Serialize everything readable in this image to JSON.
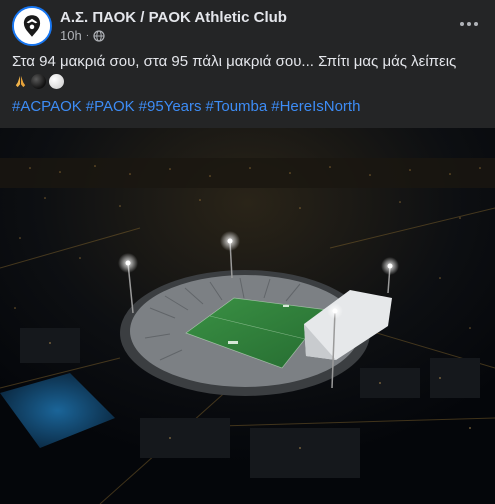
{
  "post": {
    "page_name": "Α.Σ. ΠΑΟΚ / PAOK Athletic Club",
    "time": "10h",
    "separator": "·",
    "privacy_icon": "globe-icon",
    "more_icon": "more-options-icon",
    "caption": "Στα 94 μακριά σου, στα 95 πάλι μακριά σου... Σπίτι μας μάς λείπεις",
    "emojis": [
      "folded-hands-icon",
      "black-ball-icon",
      "white-ball-icon"
    ],
    "hashtags": [
      "#ACPAOK",
      "#PAOK",
      "#95Years",
      "#Toumba",
      "#HereIsNorth"
    ],
    "photo": {
      "subject": "stadium-aerial-night-photo"
    }
  },
  "colors": {
    "background": "#242526",
    "text_primary": "#e4e6eb",
    "text_secondary": "#b0b3b8",
    "hashtag": "#3d8cf5",
    "pitch": "#2f7d3a"
  }
}
